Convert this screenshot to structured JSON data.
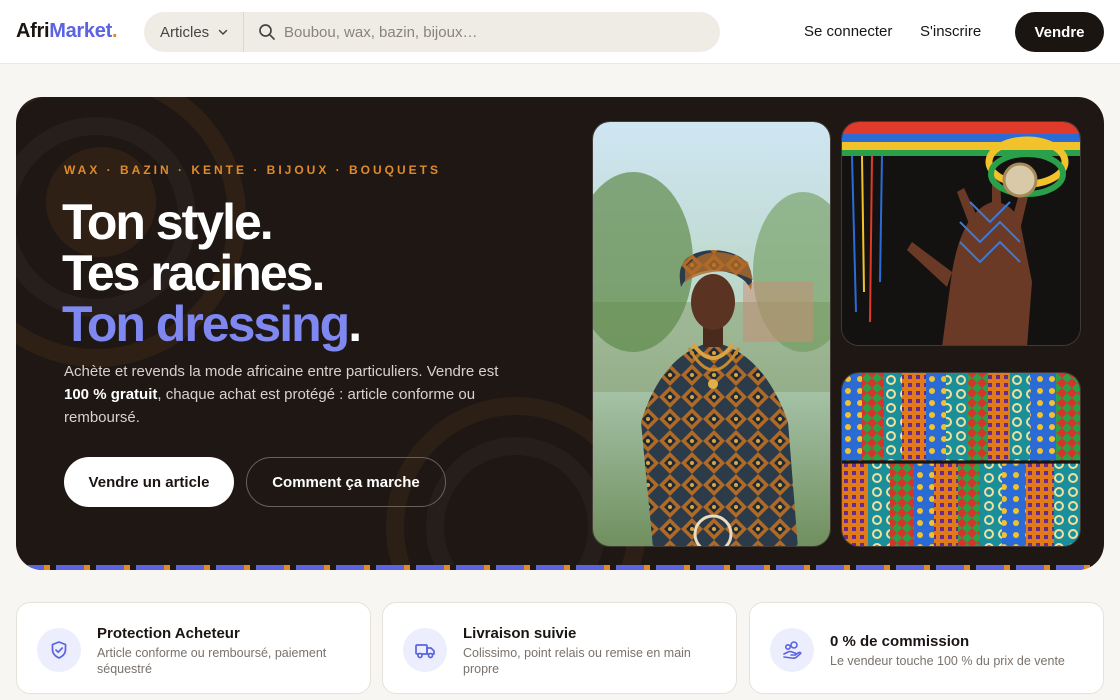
{
  "header": {
    "logo_part1": "Afri",
    "logo_part2": "Market",
    "logo_dot": ".",
    "category_select": "Articles",
    "search_placeholder": "Boubou, wax, bazin, bijoux…",
    "login": "Se connecter",
    "signup": "S'inscrire",
    "sell": "Vendre"
  },
  "hero": {
    "eyebrow": "WAX · BAZIN · KENTE · BIJOUX · BOUQUETS",
    "line1": "Ton style",
    "line2": "Tes racines",
    "line3": "Ton dressing",
    "period": ".",
    "desc_part1": "Achète et revends la mode africaine entre particuliers. Vendre est ",
    "desc_bold": "100 % gratuit",
    "desc_part2": ", chaque achat est protégé : article conforme ou remboursé.",
    "cta_primary": "Vendre un article",
    "cta_secondary": "Comment ça marche"
  },
  "features": [
    {
      "title": "Protection Acheteur",
      "subtitle": "Article conforme ou remboursé, paiement séquestré",
      "icon": "shield-icon"
    },
    {
      "title": "Livraison suivie",
      "subtitle": "Colissimo, point relais ou remise en main propre",
      "icon": "truck-icon"
    },
    {
      "title": "0 % de commission",
      "subtitle": "Le vendeur touche 100 % du prix de vente",
      "icon": "hand-coins-icon"
    }
  ],
  "colors": {
    "accent_blue": "#5b63e0",
    "accent_orange": "#e08a2a",
    "hero_bg": "#1f1713"
  }
}
